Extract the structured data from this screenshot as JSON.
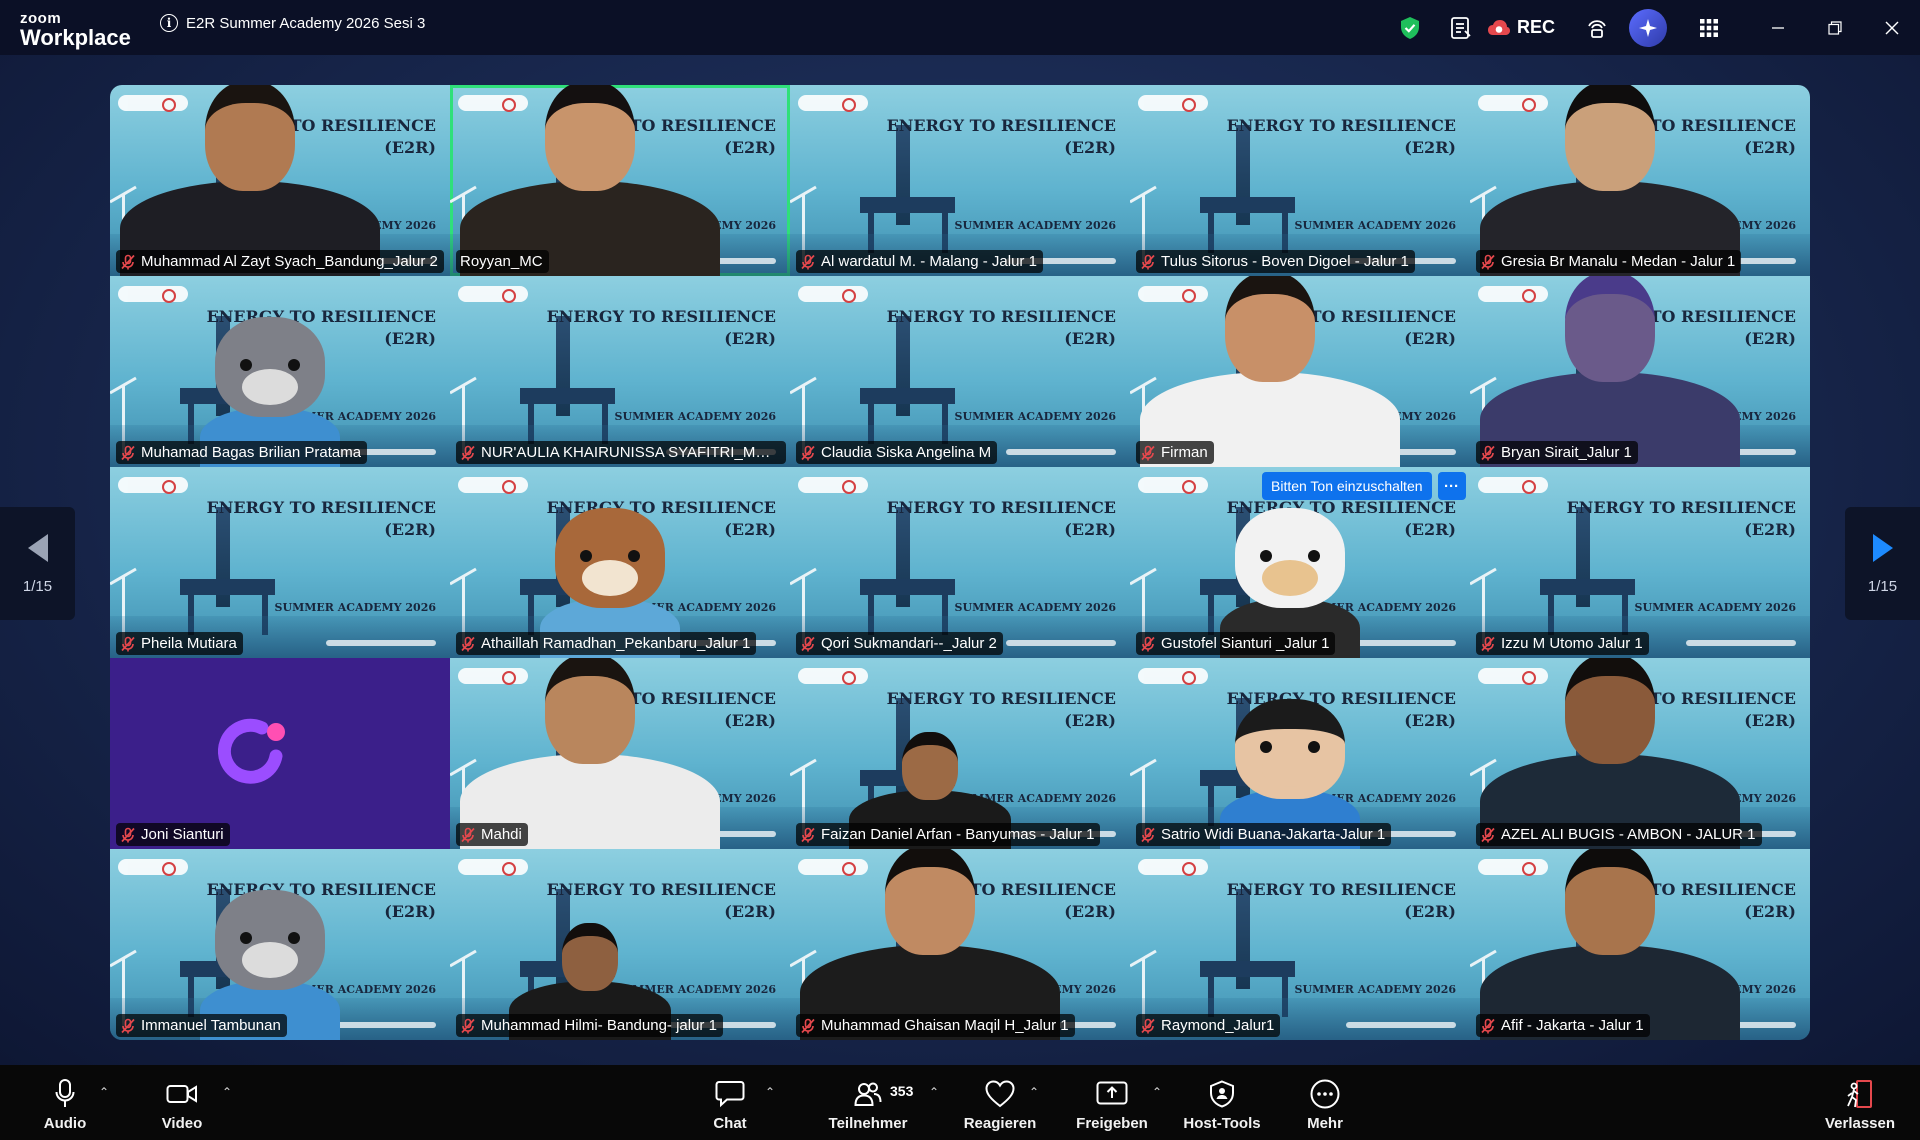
{
  "app": {
    "logo_line1": "zoom",
    "logo_line2": "Workplace",
    "meeting_title": "E2R Summer Academy 2026 Sesi 3",
    "rec_label": "REC"
  },
  "background": {
    "title_line1": "ENERGY TO RESILIENCE",
    "title_line2": "(E2R)",
    "subtitle": "SUMMER ACADEMY 2026"
  },
  "participants": [
    {
      "name": "Muhammad Al Zayt Syach_Bandung_Jalur 2",
      "muted": true,
      "video": "person",
      "skin": "#b07a52",
      "shirt": "#1e1e24",
      "hair": "#1a1410"
    },
    {
      "name": "Royyan_MC",
      "muted": false,
      "video": "person",
      "skin": "#c8946b",
      "shirt": "#2a241f",
      "hair": "#141010",
      "active": true
    },
    {
      "name": "Al wardatul M. - Malang - Jalur 1",
      "muted": true,
      "video": "bg"
    },
    {
      "name": "Tulus Sitorus - Boven Digoel - Jalur 1",
      "muted": true,
      "video": "bg"
    },
    {
      "name": "Gresia Br Manalu - Medan - Jalur 1",
      "muted": true,
      "video": "person",
      "skin": "#caa07a",
      "shirt": "#24242a",
      "hair": "#0f0d0d"
    },
    {
      "name": "Muhamad Bagas Brilian Pratama",
      "muted": true,
      "video": "avatar-wolf"
    },
    {
      "name": "NUR'AULIA KHAIRUNISSA SYAFITRI_MALA...",
      "muted": true,
      "video": "bg"
    },
    {
      "name": "Claudia Siska Angelina M",
      "muted": true,
      "video": "bg"
    },
    {
      "name": "Firman",
      "muted": true,
      "video": "person",
      "skin": "#c89068",
      "shirt": "#f1f1f1",
      "hair": "#1a1410"
    },
    {
      "name": "Bryan Sirait_Jalur 1",
      "muted": true,
      "video": "person",
      "skin": "#6a5a8a",
      "shirt": "#3b3b6a",
      "hair": "#4a3b8a"
    },
    {
      "name": "Pheila Mutiara",
      "muted": true,
      "video": "bg"
    },
    {
      "name": "Athaillah Ramadhan_Pekanbaru_Jalur 1",
      "muted": true,
      "video": "avatar-dog"
    },
    {
      "name": "Qori Sukmandari--_Jalur 2",
      "muted": true,
      "video": "bg"
    },
    {
      "name": "Gustofel Sianturi _Jalur 1",
      "muted": true,
      "video": "avatar-cow"
    },
    {
      "name": "Izzu M Utomo Jalur 1",
      "muted": true,
      "video": "bg"
    },
    {
      "name": "Joni Sianturi",
      "muted": true,
      "video": "purple"
    },
    {
      "name": "Mahdi",
      "muted": true,
      "video": "person",
      "skin": "#b9865d",
      "shirt": "#ececec",
      "hair": "#1a1410"
    },
    {
      "name": "Faizan Daniel Arfan - Banyumas - Jalur 1",
      "muted": true,
      "video": "person-small",
      "skin": "#9c6a45",
      "shirt": "#1a1a1a",
      "hair": "#120e0c"
    },
    {
      "name": "Satrio Widi Buana-Jakarta-Jalur 1",
      "muted": true,
      "video": "avatar-boy"
    },
    {
      "name": "AZEL ALI BUGIS - AMBON - JALUR 1",
      "muted": true,
      "video": "person",
      "skin": "#8a5a3a",
      "shirt": "#1d2a38",
      "hair": "#120e0c"
    },
    {
      "name": "Immanuel Tambunan",
      "muted": true,
      "video": "avatar-wolf"
    },
    {
      "name": "Muhammad Hilmi- Bandung- jalur 1",
      "muted": true,
      "video": "person-small",
      "skin": "#8e6040",
      "shirt": "#1a1a1a",
      "hair": "#120e0c"
    },
    {
      "name": "Muhammad Ghaisan Maqil H_Jalur 1",
      "muted": true,
      "video": "person",
      "skin": "#c08a62",
      "shirt": "#1c1c1c",
      "hair": "#120e0c"
    },
    {
      "name": "Raymond_Jalur1",
      "muted": true,
      "video": "bg"
    },
    {
      "name": "Afif - Jakarta - Jalur 1",
      "muted": true,
      "video": "person",
      "skin": "#a8744c",
      "shirt": "#1d2733",
      "hair": "#0e0c0b"
    }
  ],
  "unmute_request": {
    "label": "Bitten Ton einzuschalten",
    "more": "···"
  },
  "pager": {
    "left_label": "1/15",
    "right_label": "1/15"
  },
  "toolbar": {
    "audio": "Audio",
    "video": "Video",
    "chat": "Chat",
    "participants": "Teilnehmer",
    "participant_count": "353",
    "react": "Reagieren",
    "share": "Freigeben",
    "host_tools": "Host-Tools",
    "more": "Mehr",
    "leave": "Verlassen"
  },
  "colors": {
    "accent_blue": "#0e72ed",
    "active_speaker": "#2fe07a",
    "mute_red": "#e5484d",
    "shield_green": "#1fbf5b"
  }
}
